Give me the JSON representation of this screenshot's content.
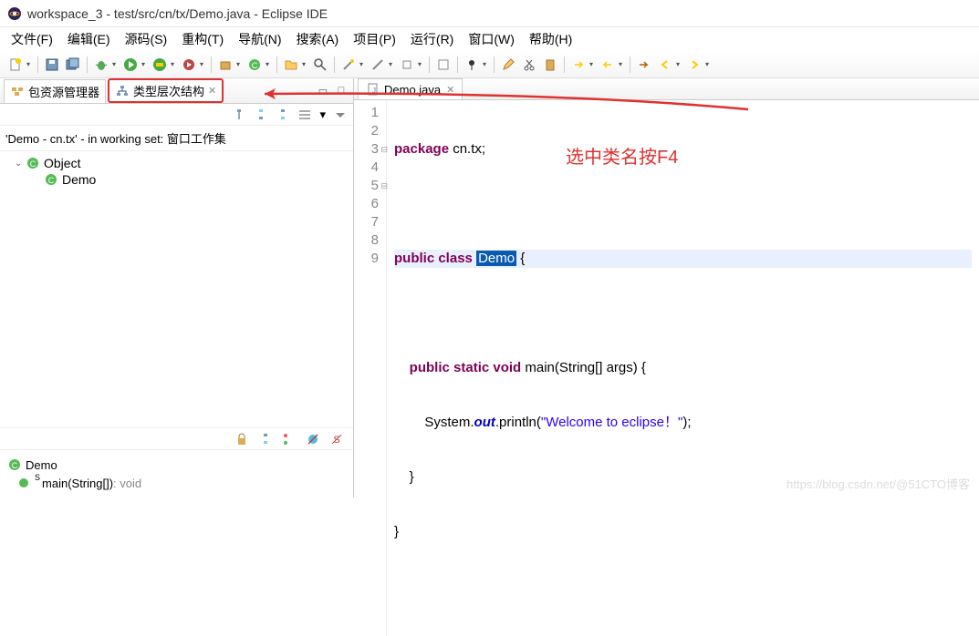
{
  "window": {
    "title": "workspace_3 - test/src/cn/tx/Demo.java - Eclipse IDE"
  },
  "menu": {
    "items": [
      "文件(F)",
      "编辑(E)",
      "源码(S)",
      "重构(T)",
      "导航(N)",
      "搜索(A)",
      "项目(P)",
      "运行(R)",
      "窗口(W)",
      "帮助(H)"
    ]
  },
  "leftPanel": {
    "tabs": {
      "package": {
        "label": "包资源管理器"
      },
      "hierarchy": {
        "label": "类型层次结构"
      }
    },
    "info": "'Demo - cn.tx' - in working set: 窗口工作集",
    "tree": {
      "root": {
        "label": "Object"
      },
      "child": {
        "label": "Demo"
      }
    },
    "members": {
      "class": {
        "label": "Demo"
      },
      "method": {
        "name": "main(String[])",
        "ret": " : void"
      }
    }
  },
  "editor": {
    "tab": {
      "label": "Demo.java"
    },
    "lines": {
      "1": {
        "kw1": "package",
        "rest": " cn.tx;"
      },
      "3": {
        "kw1": "public",
        "kw2": "class",
        "cls": "Demo",
        "brace": " {"
      },
      "5a": {
        "kw1": "public",
        "kw2": "static",
        "kw3": "void",
        "mth": " main",
        "args": "(String[] args) {"
      },
      "6a": {
        "pre": "        System.",
        "out": "out",
        "mid": ".println(",
        "str": "\"Welcome to eclipse！\"",
        "post": ");"
      },
      "7": "    }",
      "8": "}"
    }
  },
  "annotation": "选中类名按F4",
  "watermark": "https://blog.csdn.net/@51CTO博客"
}
